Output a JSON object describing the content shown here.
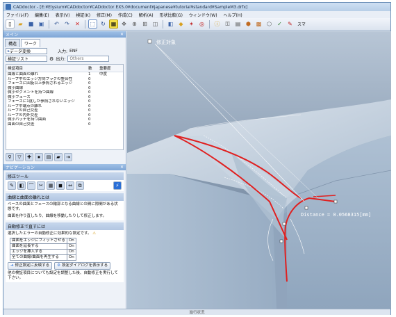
{
  "window": {
    "title": "CADdoctor - [E:¥Elysium¥CADdoctor¥CADdoctor EX5.0¥document¥japanese¥tutorial¥standard¥SampleM3.drfx]"
  },
  "menu": [
    "ファイル(F)",
    "編集(E)",
    "表示(V)",
    "検証(K)",
    "修正(M)",
    "作成(C)",
    "解析(A)",
    "形状比較(G)",
    "ウィンドウ(W)",
    "ヘルプ(H)"
  ],
  "toolbar": {
    "right_label": "スマ"
  },
  "left_panel": {
    "header": "メイン",
    "tabs": [
      "構造",
      "ワーク"
    ],
    "data_convert": "データ変換",
    "input_label": "入力:",
    "input_value": "ENF",
    "check_list_select": "検証リスト",
    "output_label": "出力:",
    "output_value": "Others",
    "table": {
      "headers": [
        "検証項目",
        "数",
        "重要度"
      ],
      "rows": [
        {
          "name": "曲線と曲面の離れ",
          "count": "1",
          "severity": "中度"
        },
        {
          "name": "ループ中のエッジ方向フラグの整合性",
          "count": "0",
          "severity": ""
        },
        {
          "name": "フェースに回旋以上参照されるエッジ",
          "count": "0",
          "severity": ""
        },
        {
          "name": "微小曲線",
          "count": "0",
          "severity": ""
        },
        {
          "name": "微小セグメントを持つ曲線",
          "count": "0",
          "severity": ""
        },
        {
          "name": "微小フェース",
          "count": "0",
          "severity": ""
        },
        {
          "name": "フェースに1度しか参照されないエッジ",
          "count": "0",
          "severity": ""
        },
        {
          "name": "ループ中端点の離れ",
          "count": "0",
          "severity": ""
        },
        {
          "name": "ループの自己交差",
          "count": "0",
          "severity": ""
        },
        {
          "name": "ループの内外交差",
          "count": "0",
          "severity": ""
        },
        {
          "name": "微小パッチを持つ曲面",
          "count": "0",
          "severity": ""
        },
        {
          "name": "曲面の自己交差",
          "count": "0",
          "severity": ""
        }
      ]
    }
  },
  "navigation": {
    "header": "ナビゲーション",
    "fix_tool_label": "修正ツール",
    "section1_title": "曲線と曲面の離れとは",
    "section1_text": "ベースの曲面とフェースの輪郭となる曲線との間に隙間がある状態です。",
    "section1_text2": "曲面を作り直したり、曲線を移動したりして修正します。",
    "section2_title": "自動修正で直すには",
    "section2_text": "選択したエラーの自動修正に効果的な設定です。",
    "settings": [
      {
        "label": "曲面をエッジにフィットさせる",
        "value": "On"
      },
      {
        "label": "曲面を延長する",
        "value": "On"
      },
      {
        "label": "エッジを挿入する",
        "value": "On"
      },
      {
        "label": "全ての曲線/曲面を再生する",
        "value": "On"
      }
    ],
    "btn_apply": "修正設定に反映する",
    "btn_dialog": "設定ダイアログを表示する",
    "footer_text": "他の検証項目についても設定を調整した後、自動修正を実行して下さい。"
  },
  "viewport": {
    "callout_label": "修正対象",
    "measure_text": "Distance = 0.0568315[mm]"
  },
  "status": {
    "progress_label": "進行状況"
  },
  "colors": {
    "model": "#9fb4cc",
    "edge": "#e02020",
    "bg_top": "#a8b8cc",
    "bg_bottom": "#5f7590"
  }
}
